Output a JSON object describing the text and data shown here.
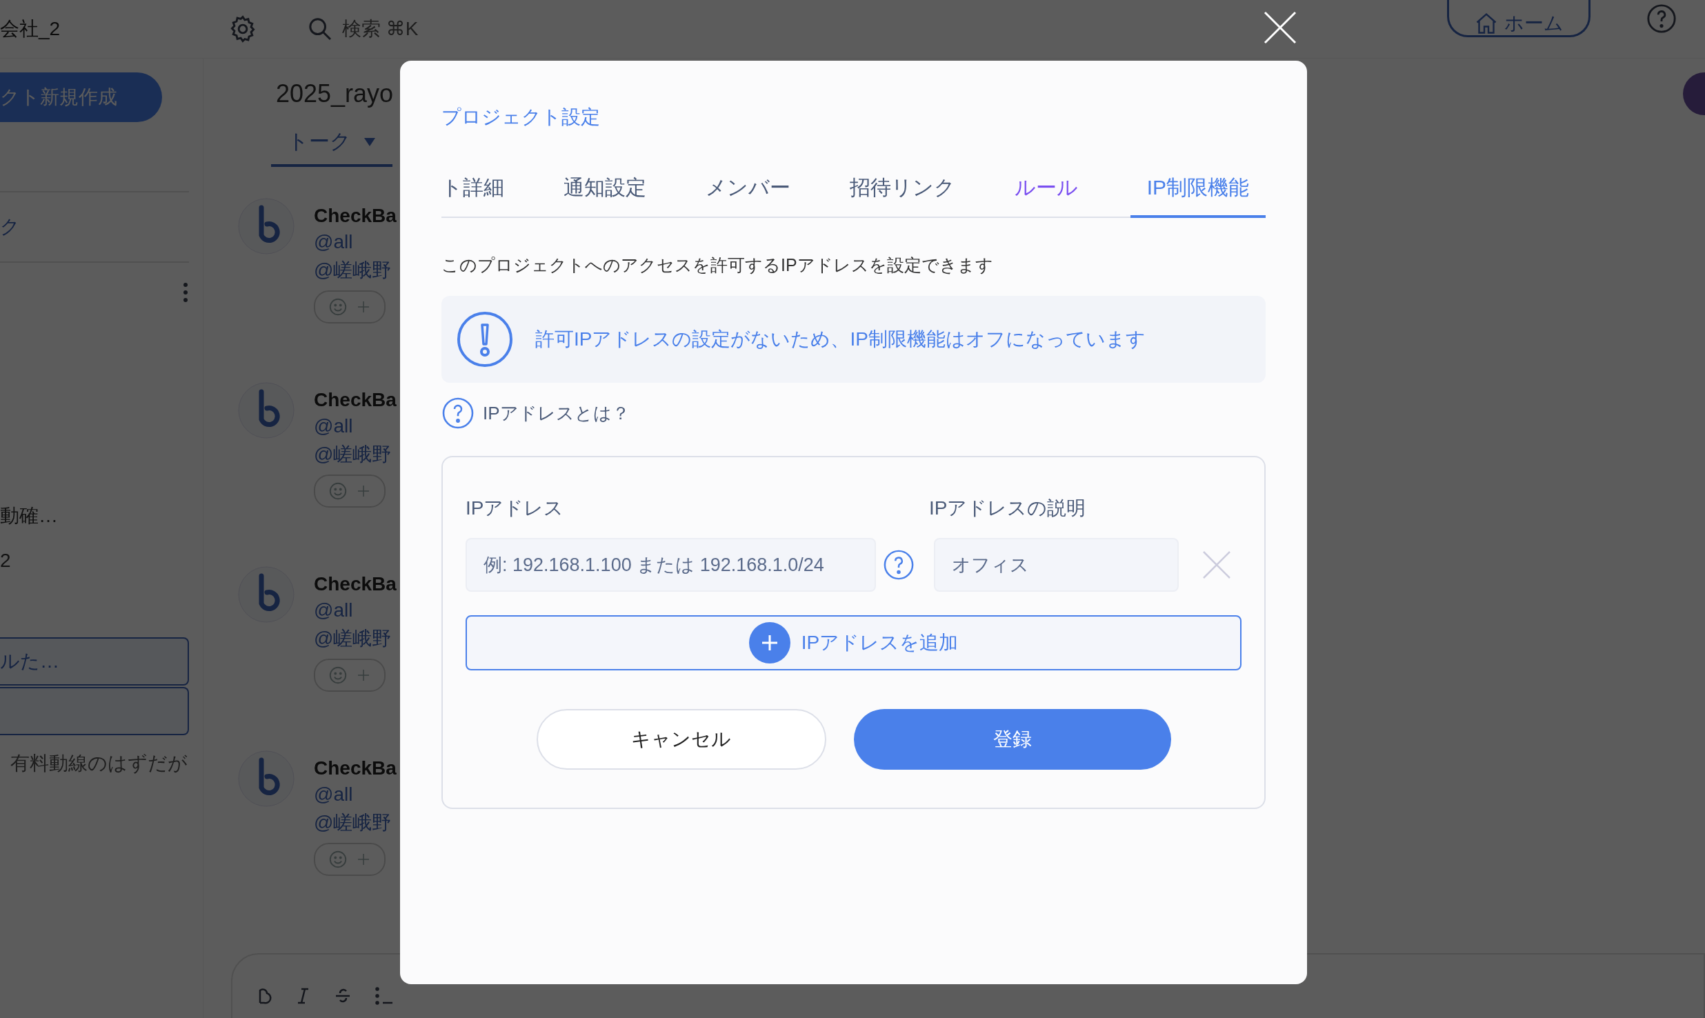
{
  "header": {
    "company": "会社_2",
    "search": "検索 ⌘K",
    "home_button": "ホーム"
  },
  "sidebar": {
    "new_project_button": "クト新規作成",
    "items": [
      {
        "kind": "link",
        "label": "ク"
      },
      {
        "kind": "menu"
      },
      {
        "kind": "text",
        "label": "動確…"
      },
      {
        "kind": "text",
        "label": "2"
      },
      {
        "kind": "card",
        "label": "ルた…"
      },
      {
        "kind": "card"
      },
      {
        "kind": "note",
        "label": "有料動線のはずだが"
      }
    ]
  },
  "main": {
    "title": "2025_rayo",
    "tabs": [
      {
        "label": "トーク",
        "selected": true
      }
    ],
    "messages": [
      {
        "author": "CheckBa",
        "lines": [
          "@all",
          "@嵯峨野"
        ]
      },
      {
        "author": "CheckBa",
        "lines": [
          "@all",
          "@嵯峨野"
        ]
      },
      {
        "author": "CheckBa",
        "lines": [
          "@all",
          "@嵯峨野"
        ]
      },
      {
        "author": "CheckBa",
        "lines": [
          "@all",
          "@嵯峨野"
        ]
      }
    ]
  },
  "modal": {
    "title": "プロジェクト設定",
    "tabs": [
      {
        "label": "ト詳細",
        "selected": false,
        "hovered": false
      },
      {
        "label": "通知設定",
        "selected": false,
        "hovered": false
      },
      {
        "label": "メンバー",
        "selected": false,
        "hovered": false
      },
      {
        "label": "招待リンク",
        "selected": false,
        "hovered": false
      },
      {
        "label": "ルール",
        "selected": false,
        "hovered": true
      },
      {
        "label": "IP制限機能",
        "selected": true,
        "hovered": false
      }
    ],
    "description": "このプロジェクトへのアクセスを許可するIPアドレスを設定できます",
    "alert": "許可IPアドレスの設定がないため、IP制限機能はオフになっています",
    "help_link": "IPアドレスとは？",
    "form": {
      "ip_label": "IPアドレス",
      "description_label": "IPアドレスの説明",
      "rows": [
        {
          "ip_placeholder": "例: 192.168.1.100 または 192.168.1.0/24",
          "description_placeholder": "オフィス"
        }
      ],
      "add_button": "IPアドレスを追加",
      "cancel_button": "キャンセル",
      "submit_button": "登録"
    }
  }
}
